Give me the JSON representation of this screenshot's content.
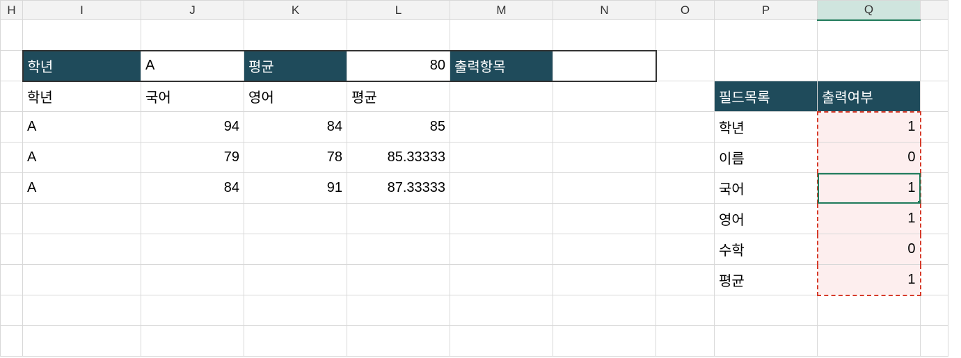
{
  "columns": [
    "H",
    "I",
    "J",
    "K",
    "L",
    "M",
    "N",
    "O",
    "P",
    "Q"
  ],
  "criteria": {
    "label_grade": "학년",
    "grade_value": "A",
    "label_avg": "평균",
    "avg_value": "80",
    "label_output": "출력항목"
  },
  "table": {
    "headers": {
      "grade": "학년",
      "kor": "국어",
      "eng": "영어",
      "avg": "평균"
    },
    "rows": [
      {
        "grade": "A",
        "kor": "94",
        "eng": "84",
        "avg": "85"
      },
      {
        "grade": "A",
        "kor": "79",
        "eng": "78",
        "avg": "85.33333"
      },
      {
        "grade": "A",
        "kor": "84",
        "eng": "91",
        "avg": "87.33333"
      }
    ]
  },
  "fieldlist": {
    "header_name": "필드목록",
    "header_flag": "출력여부",
    "items": [
      {
        "name": "학년",
        "flag": "1"
      },
      {
        "name": "이름",
        "flag": "0"
      },
      {
        "name": "국어",
        "flag": "1"
      },
      {
        "name": "영어",
        "flag": "1"
      },
      {
        "name": "수학",
        "flag": "0"
      },
      {
        "name": "평균",
        "flag": "1"
      }
    ]
  }
}
